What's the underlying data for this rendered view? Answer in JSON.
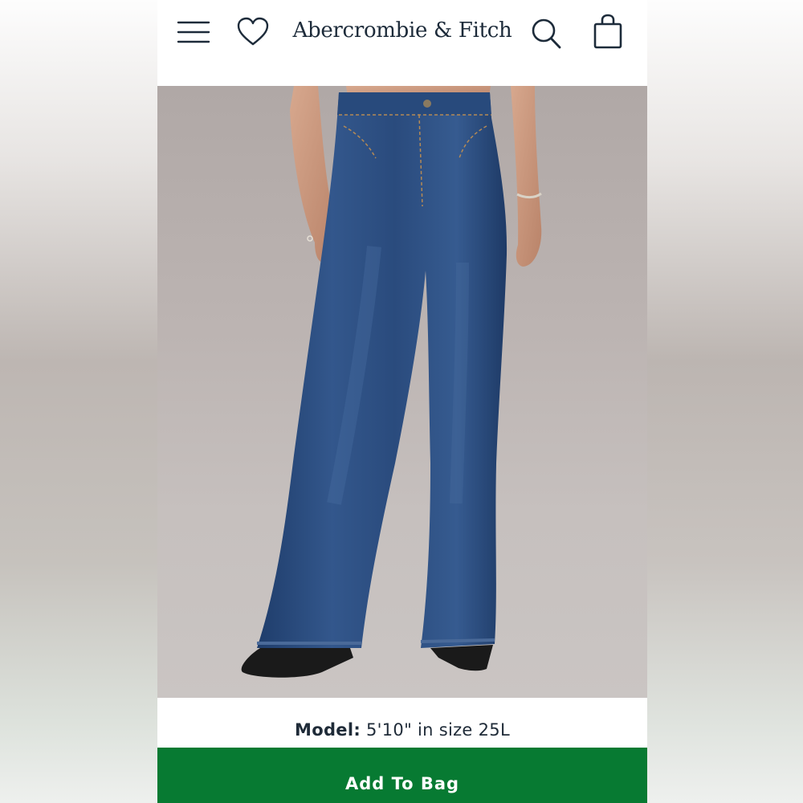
{
  "header": {
    "brand": "Abercrombie & Fitch",
    "icons": [
      "menu-icon",
      "heart-icon",
      "search-icon",
      "shopping-bag-icon"
    ]
  },
  "product": {
    "model_label": "Model:",
    "model_info": "5'10\" in size 25L"
  },
  "actions": {
    "add_to_bag_label": "Add To Bag"
  },
  "colors": {
    "brand_text": "#1d2b3a",
    "add_to_bag_bg": "#077a32",
    "background": "#ffffff"
  }
}
